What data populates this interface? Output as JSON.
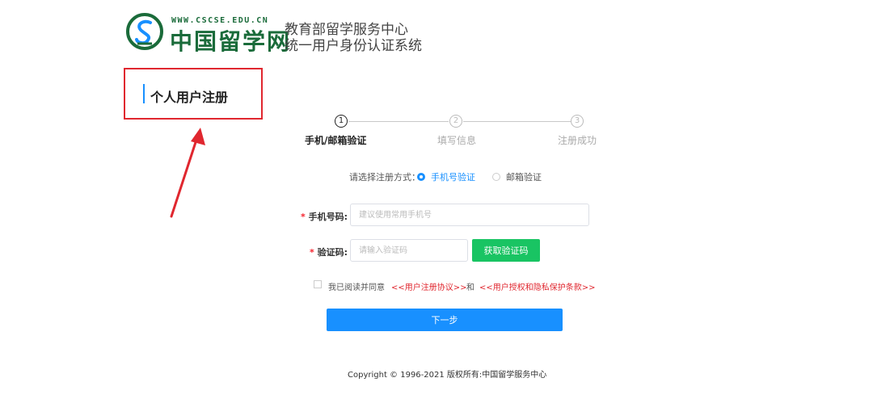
{
  "header": {
    "logo_url_text": "WWW.CSCSE.EDU.CN",
    "logo_name": "中国留学网",
    "system_title_line1": "教育部留学服务中心",
    "system_title_line2": "统一用户身份认证系统"
  },
  "page": {
    "heading": "个人用户注册"
  },
  "steps": [
    {
      "number": "1",
      "label": "手机/邮箱验证"
    },
    {
      "number": "2",
      "label": "填写信息"
    },
    {
      "number": "3",
      "label": "注册成功"
    }
  ],
  "method": {
    "label": "请选择注册方式：",
    "options": [
      {
        "label": "手机号验证",
        "selected": true
      },
      {
        "label": "邮箱验证",
        "selected": false
      }
    ]
  },
  "form": {
    "required_mark": "*",
    "phone_label": "手机号码:",
    "phone_placeholder": "建议使用常用手机号",
    "phone_value": "",
    "code_label": "验证码:",
    "code_placeholder": "请输入验证码",
    "code_value": "",
    "get_code_button": "获取验证码"
  },
  "agreement": {
    "checked": false,
    "prefix": "我已阅读并同意",
    "link_terms": "<<用户注册协议>>",
    "conjunction": "和",
    "link_privacy": "<<用户授权和隐私保护条款>>"
  },
  "actions": {
    "next_button": "下一步"
  },
  "footer": {
    "copyright": "Copyright © 1996-2021 版权所有:中国留学服务中心"
  },
  "colors": {
    "accent": "#1890ff",
    "success": "#19c463",
    "highlight": "#e0272f",
    "logo_green": "#1a6b3a"
  }
}
